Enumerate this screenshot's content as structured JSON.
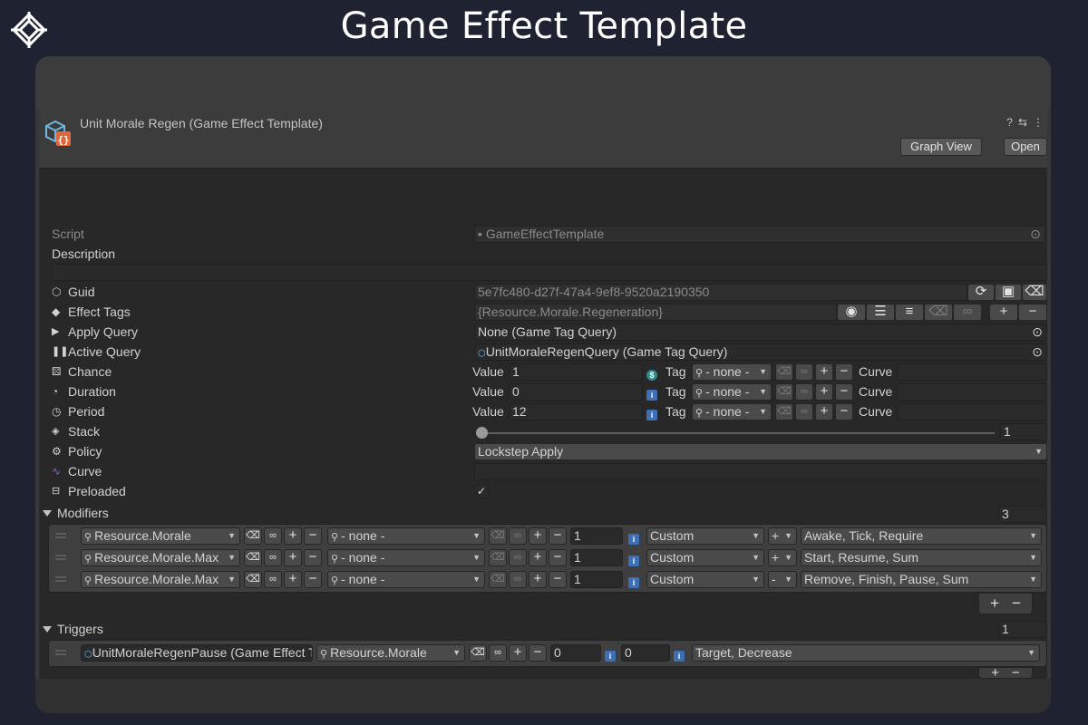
{
  "page": {
    "title": "Game Effect Template"
  },
  "header": {
    "title": "Unit Morale Regen (Game Effect Template)",
    "graph_view": "Graph View",
    "open": "Open",
    "help": "?",
    "settings": "⇆",
    "menu": "⋮"
  },
  "props": {
    "script_label": "Script",
    "script_value": "GameEffectTemplate",
    "description_label": "Description",
    "guid_label": "Guid",
    "guid_value": "5e7fc480-d27f-47a4-9ef8-9520a2190350",
    "tags_label": "Effect Tags",
    "tags_value": "{Resource.Morale.Regeneration}",
    "apply_label": "Apply Query",
    "apply_value": "None (Game Tag Query)",
    "active_label": "Active Query",
    "active_value": "UnitMoraleRegenQuery (Game Tag Query)",
    "chance_label": "Chance",
    "duration_label": "Duration",
    "period_label": "Period",
    "stack_label": "Stack",
    "stack_value": "1",
    "policy_label": "Policy",
    "policy_value": "Lockstep Apply",
    "curve_label": "Curve",
    "preloaded_label": "Preloaded",
    "preloaded_check": "✓"
  },
  "value_rows": [
    {
      "value_label": "Value",
      "value": "1",
      "tag_label": "Tag",
      "tag": "- none -",
      "curve_label": "Curve"
    },
    {
      "value_label": "Value",
      "value": "0",
      "tag_label": "Tag",
      "tag": "- none -",
      "curve_label": "Curve"
    },
    {
      "value_label": "Value",
      "value": "12",
      "tag_label": "Tag",
      "tag": "- none -",
      "curve_label": "Curve"
    }
  ],
  "modifiers": {
    "label": "Modifiers",
    "count": "3",
    "rows": [
      {
        "attribute": "Resource.Morale",
        "tag": "- none -",
        "value": "1",
        "mode": "Custom",
        "op": "+",
        "events": "Awake, Tick, Require"
      },
      {
        "attribute": "Resource.Morale.Max",
        "tag": "- none -",
        "value": "1",
        "mode": "Custom",
        "op": "+",
        "events": "Start, Resume, Sum"
      },
      {
        "attribute": "Resource.Morale.Max",
        "tag": "- none -",
        "value": "1",
        "mode": "Custom",
        "op": "-",
        "events": "Remove, Finish, Pause, Sum"
      }
    ]
  },
  "triggers": {
    "label": "Triggers",
    "count": "1",
    "rows": [
      {
        "effect": "UnitMoraleRegenPause (Game Effect Template)",
        "attribute": "Resource.Morale",
        "value_a": "0",
        "value_b": "0",
        "events": "Target, Decrease"
      }
    ]
  },
  "glyphs": {
    "plus": "+",
    "minus": "−",
    "arrow": "▼"
  },
  "colors": {
    "background": "#1f2331",
    "panel": "#282828",
    "field": "#2a2a2a",
    "accent_blue": "#3d6fb5",
    "accent_teal": "#2d8d88"
  }
}
